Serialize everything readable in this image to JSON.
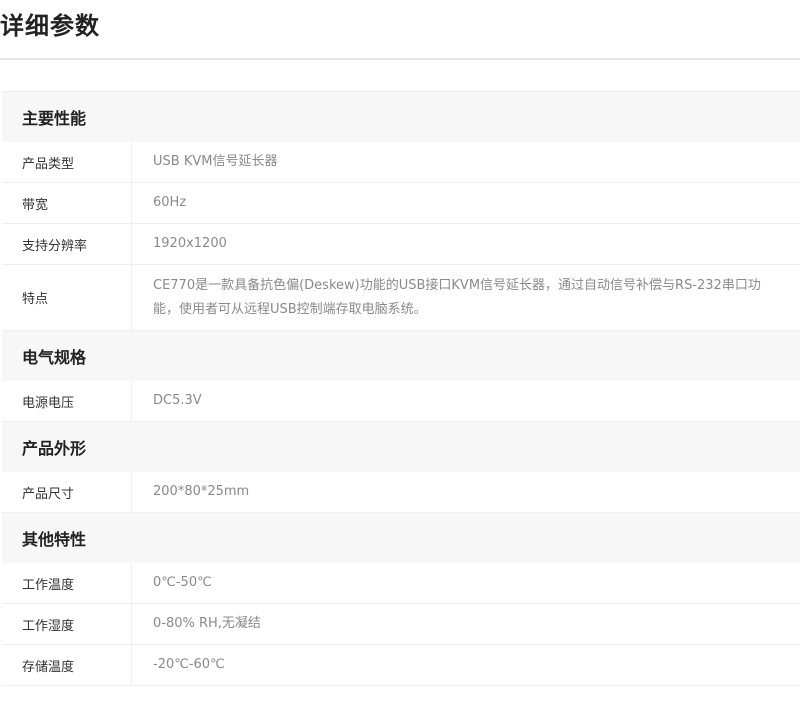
{
  "page": {
    "title": "详细参数"
  },
  "sections": [
    {
      "heading": "主要性能",
      "rows": [
        {
          "label": "产品类型",
          "value": "USB KVM信号延长器"
        },
        {
          "label": "带宽",
          "value": "60Hz"
        },
        {
          "label": "支持分辨率",
          "value": "1920x1200"
        },
        {
          "label": "特点",
          "value": "CE770是一款具备抗色偏(Deskew)功能的USB接口KVM信号延长器，通过自动信号补偿与RS-232串口功能，使用者可从远程USB控制端存取电脑系统。"
        }
      ]
    },
    {
      "heading": "电气规格",
      "rows": [
        {
          "label": "电源电压",
          "value": "DC5.3V"
        }
      ]
    },
    {
      "heading": "产品外形",
      "rows": [
        {
          "label": "产品尺寸",
          "value": "200*80*25mm"
        }
      ]
    },
    {
      "heading": "其他特性",
      "rows": [
        {
          "label": "工作温度",
          "value": "0℃-50℃"
        },
        {
          "label": "工作湿度",
          "value": "0-80% RH,无凝结"
        },
        {
          "label": "存储温度",
          "value": "-20℃-60℃"
        }
      ]
    }
  ]
}
